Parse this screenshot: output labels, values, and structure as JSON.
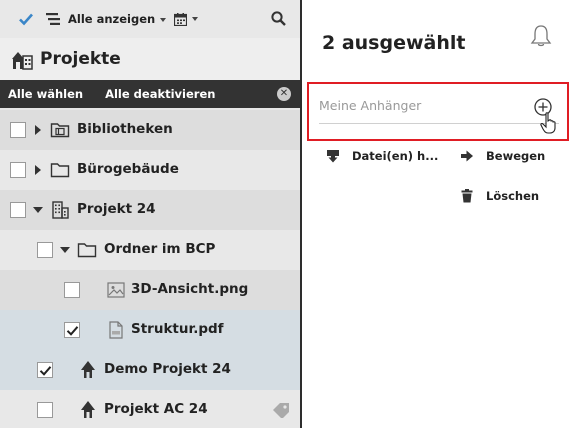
{
  "toolbar": {
    "filter_label": "Alle anzeigen",
    "icons": [
      "checkmark-icon",
      "list-icon",
      "calendar-icon",
      "search-icon"
    ]
  },
  "projects_panel": {
    "title": "Projekte",
    "select_all_label": "Alle wählen",
    "deselect_all_label": "Alle deaktivieren"
  },
  "tree": {
    "items": [
      {
        "label": "Bibliotheken",
        "icon": "library-folder-icon",
        "checked": false,
        "expanded": false
      },
      {
        "label": "Bürogebäude",
        "icon": "folder-icon",
        "checked": false,
        "expanded": false
      },
      {
        "label": "Projekt 24",
        "icon": "building-icon",
        "checked": false,
        "expanded": true
      },
      {
        "label": "Ordner im BCP",
        "icon": "folder-icon",
        "checked": false,
        "expanded": true
      },
      {
        "label": "3D-Ansicht.png",
        "icon": "image-file-icon",
        "checked": false
      },
      {
        "label": "Struktur.pdf",
        "icon": "pdf-file-icon",
        "checked": true
      },
      {
        "label": "Demo Projekt 24",
        "icon": "project-icon",
        "checked": true
      },
      {
        "label": "Projekt AC 24",
        "icon": "project-icon",
        "checked": false
      }
    ]
  },
  "details": {
    "title": "2 ausgewählt",
    "attachment_placeholder": "Meine Anhänger",
    "actions": {
      "download": "Datei(en) h...",
      "move": "Bewegen",
      "delete": "Löschen"
    }
  },
  "colors": {
    "check_blue": "#3a86c8",
    "highlight_red": "#e01d24",
    "selection_bar": "#333333"
  }
}
